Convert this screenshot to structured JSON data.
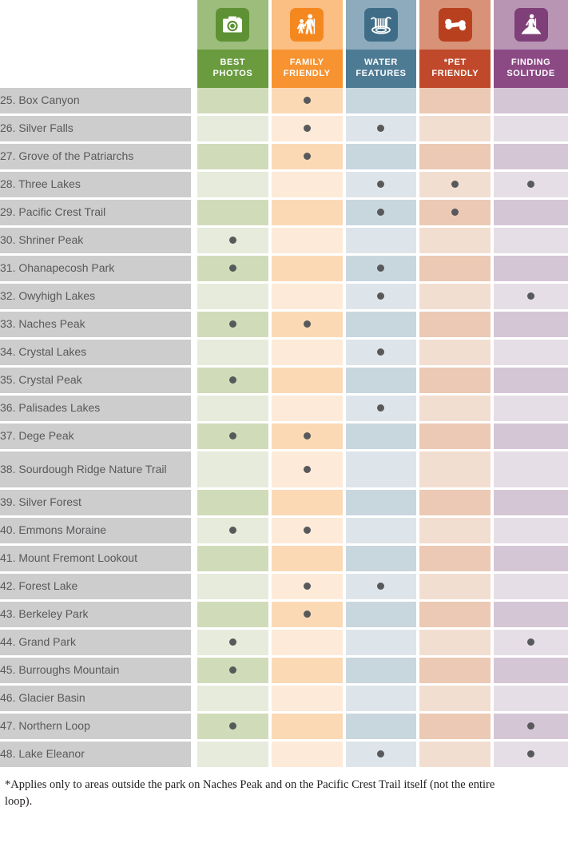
{
  "columns": [
    {
      "key": "best_photos",
      "label_line1": "BEST",
      "label_line2": "PHOTOS",
      "icon": "camera-icon",
      "header_bg": "#6a9b3f",
      "tile_bg": "#5e9134",
      "band_bg": "#9cbd7b",
      "cell_dark": "#d0dcb9",
      "cell_light": "#e6ebdb"
    },
    {
      "key": "family_friendly",
      "label_line1": "FAMILY",
      "label_line2": "FRIENDLY",
      "icon": "hikers-icon",
      "header_bg": "#f79431",
      "tile_bg": "#f4881f",
      "band_bg": "#fbbe83",
      "cell_dark": "#fcd9b5",
      "cell_light": "#fdead8"
    },
    {
      "key": "water_features",
      "label_line1": "WATER",
      "label_line2": "FEATURES",
      "icon": "waterfall-icon",
      "header_bg": "#4e7b94",
      "tile_bg": "#3f6d88",
      "band_bg": "#8dabbc",
      "cell_dark": "#c8d7de",
      "cell_light": "#dee5ea"
    },
    {
      "key": "pet_friendly",
      "label_line1": "*PET",
      "label_line2": "FRIENDLY",
      "icon": "bone-icon",
      "header_bg": "#c0492b",
      "tile_bg": "#b9401f",
      "band_bg": "#d89277",
      "cell_dark": "#ecc9b4",
      "cell_light": "#f2ded0"
    },
    {
      "key": "finding_solitude",
      "label_line1": "FINDING",
      "label_line2": "SOLITUDE",
      "icon": "hiker-peak-icon",
      "header_bg": "#8c4a85",
      "tile_bg": "#7f3f78",
      "band_bg": "#b995b4",
      "cell_dark": "#d5c6d6",
      "cell_light": "#e6dee6"
    }
  ],
  "rows": [
    {
      "label": "25. Box Canyon",
      "tall": false,
      "marks": [
        false,
        true,
        false,
        false,
        false
      ]
    },
    {
      "label": "26. Silver Falls",
      "tall": false,
      "marks": [
        false,
        true,
        true,
        false,
        false
      ]
    },
    {
      "label": "27. Grove of the Patriarchs",
      "tall": false,
      "marks": [
        false,
        true,
        false,
        false,
        false
      ]
    },
    {
      "label": "28. Three Lakes",
      "tall": false,
      "marks": [
        false,
        false,
        true,
        true,
        true
      ]
    },
    {
      "label": "29. Pacific Crest Trail",
      "tall": false,
      "marks": [
        false,
        false,
        true,
        true,
        false
      ]
    },
    {
      "label": "30. Shriner Peak",
      "tall": false,
      "marks": [
        true,
        false,
        false,
        false,
        false
      ]
    },
    {
      "label": "31. Ohanapecosh Park",
      "tall": false,
      "marks": [
        true,
        false,
        true,
        false,
        false
      ]
    },
    {
      "label": "32. Owyhigh Lakes",
      "tall": false,
      "marks": [
        false,
        false,
        true,
        false,
        true
      ]
    },
    {
      "label": "33. Naches Peak",
      "tall": false,
      "marks": [
        true,
        true,
        false,
        false,
        false
      ]
    },
    {
      "label": "34. Crystal Lakes",
      "tall": false,
      "marks": [
        false,
        false,
        true,
        false,
        false
      ]
    },
    {
      "label": "35. Crystal Peak",
      "tall": false,
      "marks": [
        true,
        false,
        false,
        false,
        false
      ]
    },
    {
      "label": "36. Palisades Lakes",
      "tall": false,
      "marks": [
        false,
        false,
        true,
        false,
        false
      ]
    },
    {
      "label": "37. Dege Peak",
      "tall": false,
      "marks": [
        true,
        true,
        false,
        false,
        false
      ]
    },
    {
      "label": "38. Sourdough Ridge Nature Trail",
      "tall": true,
      "marks": [
        false,
        true,
        false,
        false,
        false
      ]
    },
    {
      "label": "39. Silver Forest",
      "tall": false,
      "marks": [
        false,
        false,
        false,
        false,
        false
      ]
    },
    {
      "label": "40. Emmons Moraine",
      "tall": false,
      "marks": [
        true,
        true,
        false,
        false,
        false
      ]
    },
    {
      "label": "41. Mount Fremont Lookout",
      "tall": false,
      "marks": [
        false,
        false,
        false,
        false,
        false
      ]
    },
    {
      "label": "42. Forest Lake",
      "tall": false,
      "marks": [
        false,
        true,
        true,
        false,
        false
      ]
    },
    {
      "label": "43. Berkeley Park",
      "tall": false,
      "marks": [
        false,
        true,
        false,
        false,
        false
      ]
    },
    {
      "label": "44. Grand Park",
      "tall": false,
      "marks": [
        true,
        false,
        false,
        false,
        true
      ]
    },
    {
      "label": "45. Burroughs Mountain",
      "tall": false,
      "marks": [
        true,
        false,
        false,
        false,
        false
      ]
    },
    {
      "label": "46. Glacier Basin",
      "tall": false,
      "marks": [
        false,
        false,
        false,
        false,
        false
      ]
    },
    {
      "label": "47. Northern Loop",
      "tall": false,
      "marks": [
        true,
        false,
        false,
        false,
        true
      ]
    },
    {
      "label": "48. Lake Eleanor",
      "tall": false,
      "marks": [
        false,
        false,
        true,
        false,
        true
      ]
    }
  ],
  "footnote": {
    "text": "*Applies only to areas outside the park on Naches Peak and on the Pacific Crest Trail itself (not the entire loop)."
  },
  "colors": {
    "row_label_bg": "#cdcdcd",
    "row_label_text": "#58595b",
    "dot": "#58595b",
    "page_bg": "#ffffff",
    "footnote_text": "#231f20"
  }
}
